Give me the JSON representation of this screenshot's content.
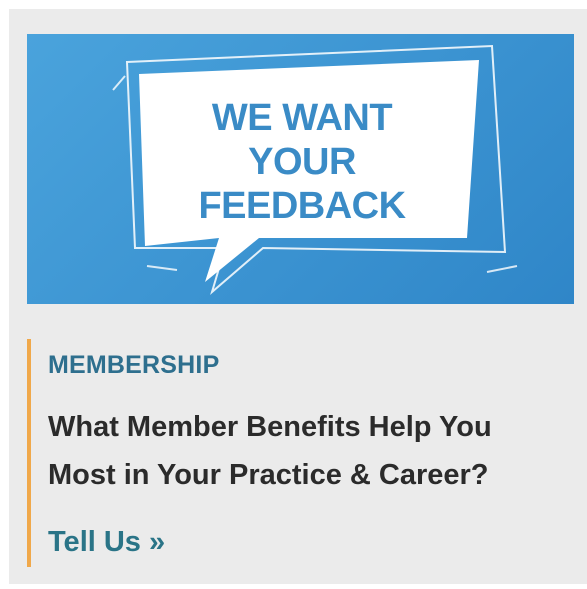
{
  "banner": {
    "line1": "WE WANT",
    "line2": "YOUR",
    "line3": "FEEDBACK",
    "icon": "speech-bubble-icon",
    "background_color": "#3b93d1",
    "text_color": "#3a8bc6"
  },
  "article": {
    "category": "MEMBERSHIP",
    "headline_line1": "What Member Benefits Help You",
    "headline_line2": "Most in Your Practice & Career?",
    "cta": "Tell Us »",
    "accent_color": "#f0a84a",
    "category_color": "#2e6f8e",
    "cta_color": "#2a7487"
  }
}
